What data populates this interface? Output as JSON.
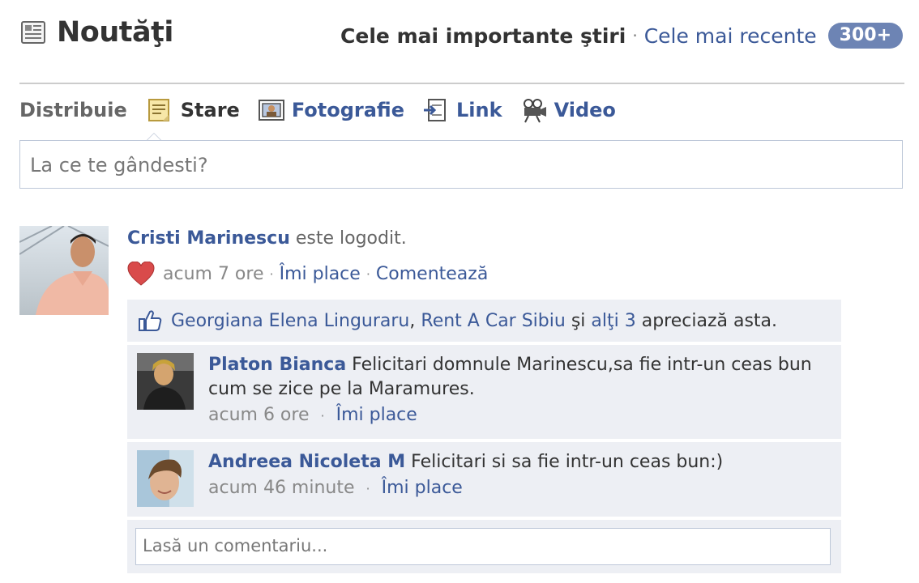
{
  "header": {
    "title": "Noutăţi",
    "icon": "news-feed-icon",
    "sort_top": "Cele mai importante ştiri",
    "separator": "·",
    "sort_recent": "Cele mai recente",
    "badge": "300+"
  },
  "share": {
    "label": "Distribuie",
    "items": [
      {
        "label": "Stare",
        "icon": "status-icon",
        "active": true
      },
      {
        "label": "Fotografie",
        "icon": "photo-icon",
        "active": false
      },
      {
        "label": "Link",
        "icon": "link-icon",
        "active": false
      },
      {
        "label": "Video",
        "icon": "video-camera-icon",
        "active": false
      }
    ],
    "placeholder": "La ce te gândesti?"
  },
  "story": {
    "actor": "Cristi Marinescu",
    "text": "este logodit.",
    "time": "acum 7 ore",
    "like_action": "Îmi place",
    "comment_action": "Comentează",
    "likes": {
      "name1": "Georgiana Elena Linguraru",
      "comma": ",",
      "name2": "Rent A Car Sibiu",
      "and": "şi",
      "others": "alţi 3",
      "suffix": "apreciază asta."
    },
    "comments": [
      {
        "name": "Platon Bianca",
        "text": "Felicitari domnule Marinescu,sa fie intr-un ceas bun cum se zice pe la Maramures.",
        "time": "acum 6 ore",
        "like": "Îmi place"
      },
      {
        "name": "Andreea Nicoleta M",
        "text": "Felicitari si sa fie intr-un ceas bun:)",
        "time": "acum 46 minute",
        "like": "Îmi place"
      }
    ],
    "reply_placeholder": "Lasă un comentariu..."
  },
  "colors": {
    "link": "#3b5998",
    "ufi_background": "#edeff4",
    "badge": "#6d84b4",
    "heart": "#d9534f"
  }
}
